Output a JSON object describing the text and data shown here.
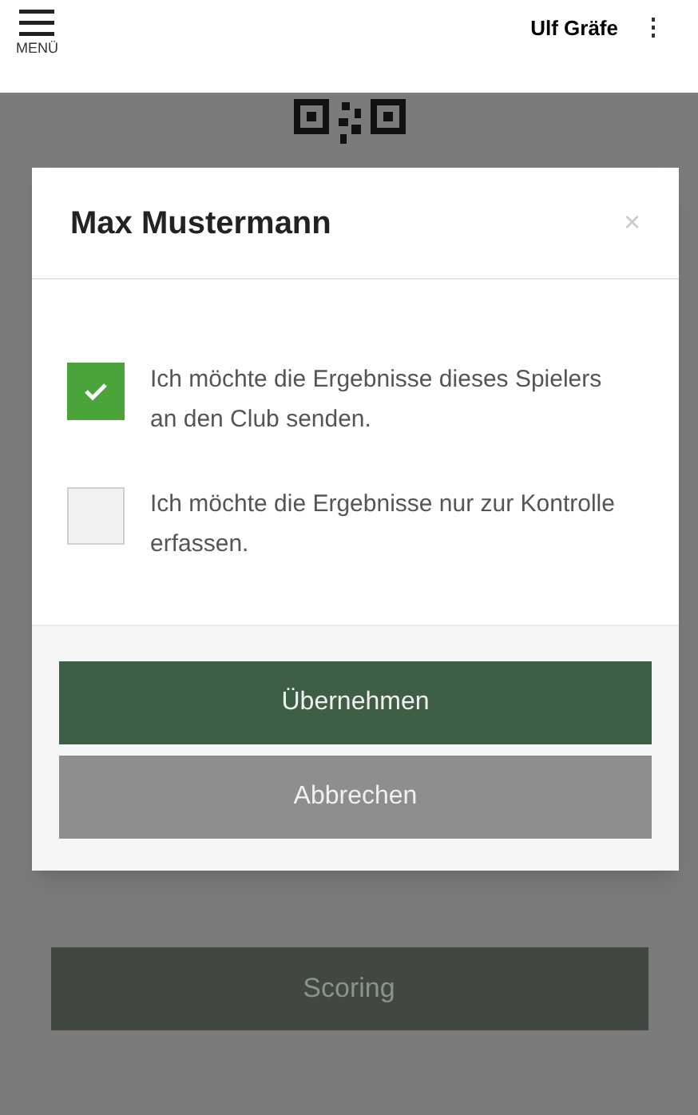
{
  "header": {
    "menu_label": "MENÜ",
    "user_name": "Ulf Gräfe"
  },
  "background": {
    "scoring_button": "Scoring"
  },
  "dialog": {
    "title": "Max Mustermann",
    "close": "×",
    "options": [
      {
        "label": "Ich möchte die Ergebnisse dieses Spielers an den Club senden.",
        "checked": true
      },
      {
        "label": "Ich möchte die Ergebnisse nur zur Kontrolle erfassen.",
        "checked": false
      }
    ],
    "buttons": [
      {
        "label": "Übernehmen",
        "kind": "primary"
      },
      {
        "label": "Abbrechen",
        "kind": "secondary"
      }
    ]
  }
}
